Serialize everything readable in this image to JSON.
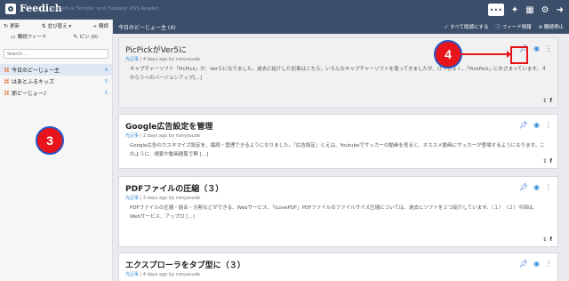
{
  "header": {
    "brand": "Feedich",
    "tagline": "Feedich is 'Simple' and 'Snappy' RSS Reader.",
    "icons": [
      "user-menu-icon",
      "run-icon",
      "grid-icon",
      "settings-icon",
      "logout-icon"
    ]
  },
  "sidebar": {
    "toolbar_row1": [
      {
        "icon": "refresh-icon",
        "label": "更新"
      },
      {
        "icon": "sort-icon",
        "label": "並び替え ▾"
      },
      {
        "icon": "add-icon",
        "label": "+ 購読"
      }
    ],
    "toolbar_row2": [
      {
        "icon": "feed-icon",
        "label": "購読フィード"
      },
      {
        "icon": "pin-icon",
        "label": "ピン (0)"
      }
    ],
    "search_placeholder": "Search...",
    "feeds": [
      {
        "label": "今日のどーじょー主",
        "count": "4",
        "active": true
      },
      {
        "label": "はあとふるキッズ",
        "count": "5",
        "active": false
      },
      {
        "label": "邪どーじょー♪",
        "count": "5",
        "active": false
      }
    ],
    "marker_label": "3"
  },
  "main": {
    "subbar_title": "今日のどーじょー主 (4)",
    "subbar_actions": [
      "✓ すべて既読にする",
      "ⓘ フィード情報",
      "⊘ 購読停止"
    ],
    "marker_label": "4",
    "articles": [
      {
        "title": "PicPickがVer5に",
        "category": "光記事",
        "meta": " | 4 days ago by nonyasude",
        "body": "キャプチャーソフト「PicPick」が、Ver５になりました。過去に紹介した記事はこちら。いろんなキャプチャーソフトを使ってきましたが、けっきょく、「PickPick」におさまっています。４からうへのバージョンアップ[...]"
      },
      {
        "title": "Google広告設定を管理",
        "category": "光記事",
        "meta": " | 2 days ago by nonyasude",
        "body": "Google広告のカスタマイズ設定を、編続・管理できるようになりました。「広告設定」とえは、Youtubeでサッカーの動画を見ると、オススメ動画にサッカーが登場するようになります。このように、視索や動画閲覧で興 [...]"
      },
      {
        "title": "PDFファイルの圧縮（３）",
        "category": "光記事",
        "meta": " | 3 days ago by nonyasude",
        "body": "PDFファイルの圧縮・結合・分割などができる、Webサービス、「iLovePDF」PDFファイルのファイルサイズ圧縮については、過去にソフトを２つ紹介しています。（１）　（２）今回は、Webサービス、アップロ [...]"
      },
      {
        "title": "エクスプローラをタブ型に（３）",
        "category": "光記事",
        "meta": " | 4 days ago by nonyasude",
        "body": ""
      }
    ]
  }
}
